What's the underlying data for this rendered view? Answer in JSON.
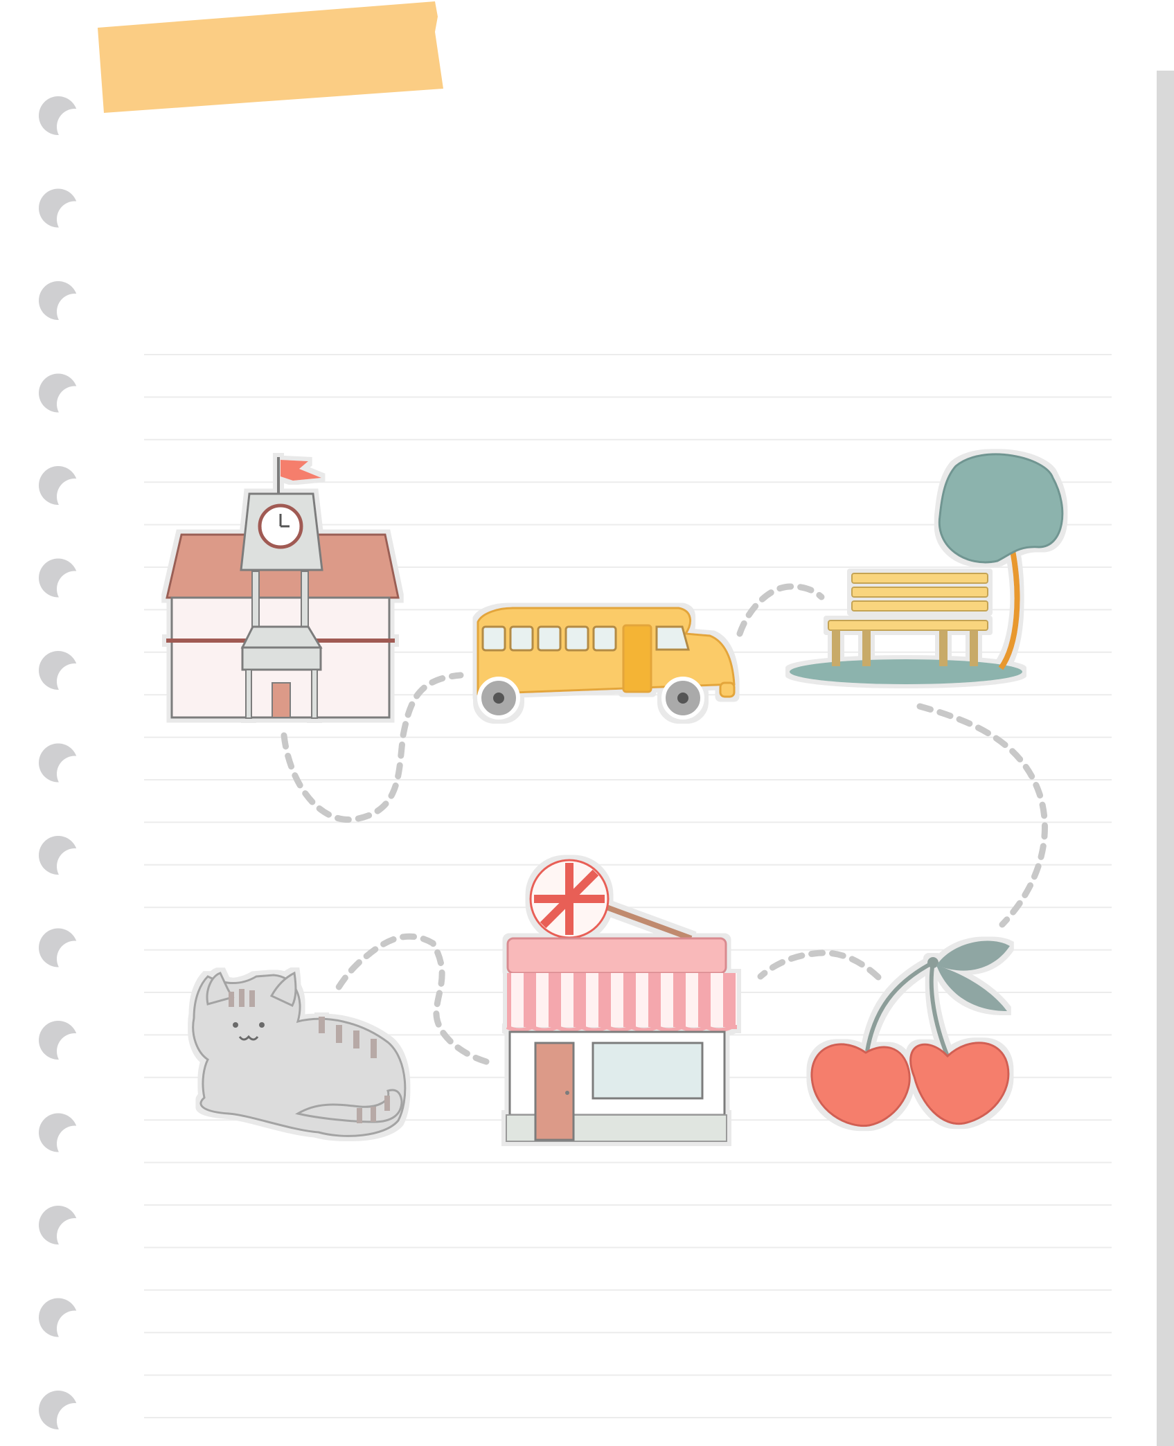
{
  "notebook": {
    "background_color": "#ffffff",
    "rule_line_color": "#ececec",
    "rule_line_count": 26,
    "binding_hole_count": 15,
    "binding_hole_color": "#cfcfd1",
    "tape_color": "#fbcd84",
    "side_strip_color": "#d9d9d9"
  },
  "path": {
    "style": "dashed",
    "color": "#c8c8c8"
  },
  "stickers": [
    {
      "name": "school-building",
      "icon": "school-icon"
    },
    {
      "name": "school-bus",
      "icon": "bus-icon"
    },
    {
      "name": "park-bench",
      "icon": "bench-tree-icon"
    },
    {
      "name": "cherries",
      "icon": "cherry-icon"
    },
    {
      "name": "candy-shop",
      "icon": "candy-shop-icon"
    },
    {
      "name": "cat",
      "icon": "cat-icon"
    }
  ],
  "palette": {
    "coral": "#f57e6c",
    "roof": "#dc9a88",
    "yellow": "#fbcb68",
    "teal": "#8cb3ad",
    "pink": "#f9b9ba",
    "gray": "#dcdcdc"
  }
}
